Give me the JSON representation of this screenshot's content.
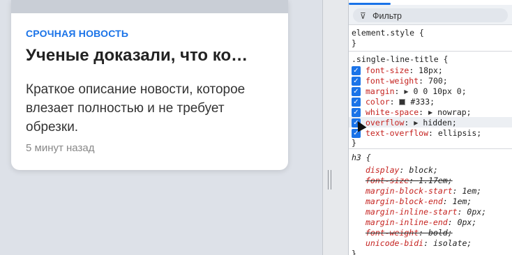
{
  "card": {
    "label": "СРОЧНАЯ НОВОСТЬ",
    "title": "Ученые доказали, что ко…",
    "description": "Краткое описание новости, которое влезает полностью и не требует обрезки.",
    "time": "5 минут назад"
  },
  "devtools": {
    "filter_placeholder": "Фильтр",
    "element_style": {
      "selector": "element.style {",
      "close": "}"
    },
    "rule1": {
      "selector": ".single-line-title {",
      "close": "}",
      "props": [
        {
          "name": "font-size",
          "value": "18px;"
        },
        {
          "name": "font-weight",
          "value": "700;"
        },
        {
          "name": "margin",
          "value": "0 0 10px 0;"
        },
        {
          "name": "color",
          "value": "#333;"
        },
        {
          "name": "white-space",
          "value": "nowrap;"
        },
        {
          "name": "overflow",
          "value": "hidden;"
        },
        {
          "name": "text-overflow",
          "value": "ellipsis;"
        }
      ]
    },
    "rule2": {
      "selector": "h3 {",
      "close": "}",
      "props": [
        {
          "name": "display",
          "value": "block;"
        },
        {
          "name": "font-size",
          "value": "1.17em;"
        },
        {
          "name": "margin-block-start",
          "value": "1em;"
        },
        {
          "name": "margin-block-end",
          "value": "1em;"
        },
        {
          "name": "margin-inline-start",
          "value": "0px;"
        },
        {
          "name": "margin-inline-end",
          "value": "0px;"
        },
        {
          "name": "font-weight",
          "value": "bold;"
        },
        {
          "name": "unicode-bidi",
          "value": "isolate;"
        }
      ]
    }
  },
  "colors": {
    "accent": "#1a73e8",
    "swatch": "#333333",
    "property": "#c5221f"
  },
  "icons": {
    "filter": "filter-icon",
    "checkbox": "checkbox-checked-icon",
    "expand": "triangle-right-icon"
  }
}
